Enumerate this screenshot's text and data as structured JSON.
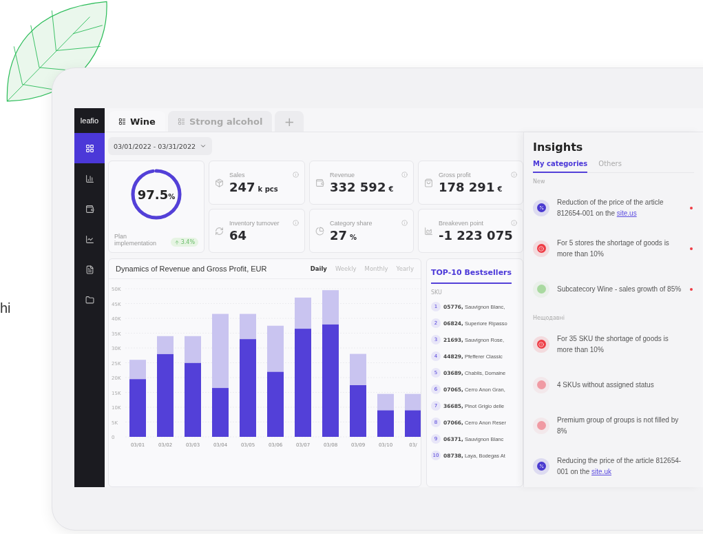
{
  "page_text": "hi",
  "sidebar": {
    "logo": "leafio",
    "items": [
      {
        "selected": true
      },
      {
        "selected": false
      },
      {
        "selected": false
      },
      {
        "selected": false
      },
      {
        "selected": false
      },
      {
        "selected": false
      }
    ]
  },
  "tabs": [
    {
      "label": "Wine",
      "selected": true
    },
    {
      "label": "Strong alcohol",
      "selected": false
    }
  ],
  "add_tab": "+",
  "date_range": "03/01/2022 - 03/31/2022",
  "plan": {
    "value": "97.5",
    "unit": "%",
    "level": 0.975,
    "label": "Plan implementation",
    "change": "3.4%"
  },
  "kpis": [
    {
      "label": "Sales",
      "value": "247",
      "unit": "k pcs"
    },
    {
      "label": "Revenue",
      "value": "332 592",
      "unit": "€"
    },
    {
      "label": "Gross profit",
      "value": "178 291",
      "unit": "€"
    },
    {
      "label": "Inventory turnover",
      "value": "64"
    },
    {
      "label": "Category share",
      "value": "27",
      "unit": "%"
    },
    {
      "label": "Breakeven point",
      "value": "-1 223 075"
    }
  ],
  "chart_card": {
    "title": "Dynamics of Revenue and Gross Profit, EUR",
    "periods": [
      {
        "label": "Daily",
        "selected": true
      },
      {
        "label": "Weekly",
        "selected": false
      },
      {
        "label": "Monthly",
        "selected": false
      },
      {
        "label": "Yearly",
        "selected": false
      }
    ],
    "chart_data": {
      "type": "bar",
      "categories": [
        "03/01",
        "03/02",
        "03/03",
        "03/04",
        "03/05",
        "03/06",
        "03/07",
        "03/08",
        "03/09",
        "03/10",
        "03/"
      ],
      "stacked": true,
      "grid": true,
      "ylim": [
        0,
        50000
      ],
      "yticks": [
        {
          "value": 0,
          "label": "0"
        },
        {
          "value": 5000,
          "label": "5K"
        },
        {
          "value": 10000,
          "label": "10K"
        },
        {
          "value": 15000,
          "label": "15K"
        },
        {
          "value": 20000,
          "label": "20K"
        },
        {
          "value": 25000,
          "label": "25K"
        },
        {
          "value": 30000,
          "label": "30K"
        },
        {
          "value": 35000,
          "label": "35K"
        },
        {
          "value": 40000,
          "label": "40K"
        },
        {
          "value": 45000,
          "label": "45K"
        },
        {
          "value": 50000,
          "label": "50K"
        }
      ],
      "series": [
        {
          "color": "#5340d8",
          "values": [
            19500,
            28000,
            25000,
            16500,
            33000,
            22000,
            36500,
            38000,
            17500,
            9000,
            9000
          ]
        },
        {
          "color": "#c9c4f0",
          "values": [
            6500,
            6000,
            9000,
            25000,
            8500,
            15500,
            10500,
            11500,
            10500,
            5500,
            5500
          ]
        }
      ]
    }
  },
  "bestsellers": {
    "title": "TOP-10 Bestsellers",
    "column": "SKU",
    "rows": [
      {
        "rank": "1",
        "sku": "05776,",
        "name": "Sauvignon Blanc,"
      },
      {
        "rank": "2",
        "sku": "06824,",
        "name": "Superiore Ripasso"
      },
      {
        "rank": "3",
        "sku": "21693,",
        "name": "Sauvignon Rose,"
      },
      {
        "rank": "4",
        "sku": "44829,",
        "name": "Pfefferer Classic"
      },
      {
        "rank": "5",
        "sku": "03689,",
        "name": "Chablis, Domaine"
      },
      {
        "rank": "6",
        "sku": "07065,",
        "name": "Cerro Anon Gran,"
      },
      {
        "rank": "7",
        "sku": "36685,",
        "name": "Pinot Grigio delle"
      },
      {
        "rank": "8",
        "sku": "07066,",
        "name": "Cerro Anon Reser"
      },
      {
        "rank": "9",
        "sku": "06371,",
        "name": "Sauvignon Blanc"
      },
      {
        "rank": "10",
        "sku": "08738,",
        "name": "Laya, Bodegas At"
      }
    ]
  },
  "insights": {
    "title": "Insights",
    "tabs": [
      {
        "label": "My categories",
        "selected": true
      },
      {
        "label": "Others",
        "selected": false
      }
    ],
    "sections": [
      {
        "title": "New",
        "items": [
          {
            "kind": "percent",
            "color": "#4a3ad0",
            "text": "Reduction of the price of the article 812654-001 on the",
            "link": "site.us",
            "unread": true
          },
          {
            "kind": "alert",
            "color": "#ee3b44",
            "text": "For 5 stores the shortage of goods is more than 10%",
            "unread": true
          },
          {
            "kind": "dot",
            "color": "#a9d9a0",
            "text": "Subcatecory Wine - sales growth of 85%",
            "unread": true
          }
        ]
      },
      {
        "title": "Нещодавні",
        "items": [
          {
            "kind": "alert",
            "color": "#ee3b44",
            "text": "For 35 SKU the shortage of goods is more than 10%",
            "unread": false
          },
          {
            "kind": "dot",
            "color": "#f09aa3",
            "text": "4 SKUs without assigned status",
            "unread": false
          },
          {
            "kind": "dot",
            "color": "#f09aa3",
            "text": "Premium group of groups is not filled by 8%",
            "unread": false
          },
          {
            "kind": "percent",
            "color": "#4a3ad0",
            "text": "Reducing the price of the article 812654-001 on the",
            "link": "site.uk",
            "unread": false
          }
        ]
      }
    ]
  }
}
